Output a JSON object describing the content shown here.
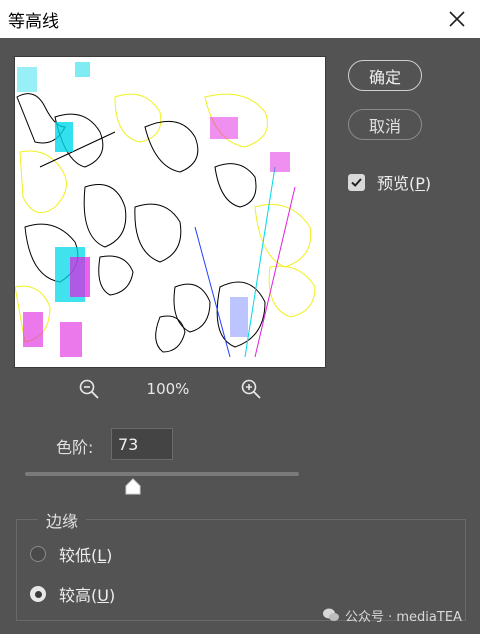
{
  "dialog": {
    "title": "等高线",
    "ok_label": "确定",
    "cancel_label": "取消",
    "preview": {
      "label": "预览(",
      "mnemonic": "P",
      "suffix": ")",
      "checked": true
    }
  },
  "preview_area": {
    "zoom_level": "100%"
  },
  "level": {
    "label": "色阶:",
    "value": "73"
  },
  "edge": {
    "legend": "边缘",
    "options": [
      {
        "label": "较低(",
        "mnemonic": "L",
        "suffix": ")",
        "selected": false
      },
      {
        "label": "较高(",
        "mnemonic": "U",
        "suffix": ")",
        "selected": true
      }
    ]
  },
  "watermark": {
    "text": "公众号 · mediaTEA"
  },
  "colors": {
    "background": "#535353",
    "titlebar": "#ffffff",
    "contour_cyan": "#00d8e8",
    "contour_magenta": "#e020e0",
    "contour_yellow": "#f0f020",
    "contour_blue": "#2040ff"
  }
}
